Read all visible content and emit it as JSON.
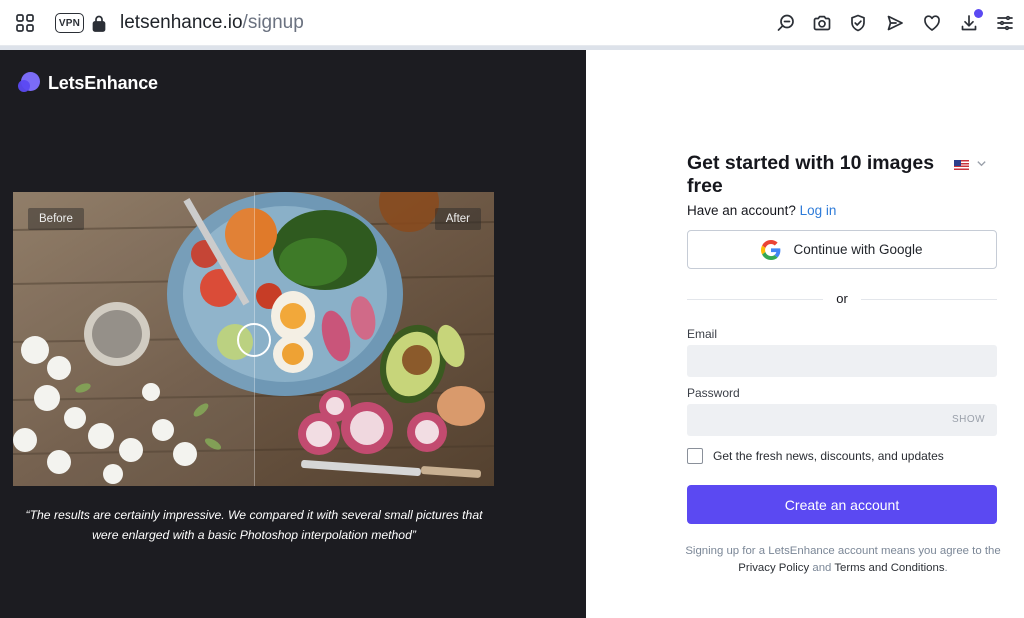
{
  "browser": {
    "vpn_label": "VPN",
    "url_host": "letsenhance.io",
    "url_path": "/signup",
    "icons": [
      "tabs-grid-icon",
      "lock-icon",
      "search-icon",
      "camera-icon",
      "shield-icon",
      "send-icon",
      "heart-icon",
      "download-icon",
      "menu-icon"
    ]
  },
  "brand": {
    "name": "LetsEnhance",
    "accent": "#5b49f2"
  },
  "showcase": {
    "before_label": "Before",
    "after_label": "After",
    "quote": "“The results are certainly impressive. We compared it with several small pictures that were enlarged with a basic Photoshop interpolation method”"
  },
  "form": {
    "title": "Get started with 10 images free",
    "have_account": "Have an account?",
    "login_link": "Log in",
    "google_button": "Continue with Google",
    "divider": "or",
    "email_label": "Email",
    "email_value": "",
    "password_label": "Password",
    "password_value": "",
    "show_label": "SHOW",
    "newsletter_label": "Get the fresh news, discounts, and updates",
    "newsletter_checked": false,
    "submit_button": "Create an account",
    "legal_prefix": "Signing up for a LetsEnhance account means you agree to the",
    "privacy_link": "Privacy Policy",
    "legal_and": "and",
    "terms_link": "Terms and Conditions",
    "legal_suffix": "."
  },
  "colors": {
    "left_panel_bg": "#1c1c21",
    "primary_button": "#5b49f2",
    "link": "#2f7cd9"
  }
}
